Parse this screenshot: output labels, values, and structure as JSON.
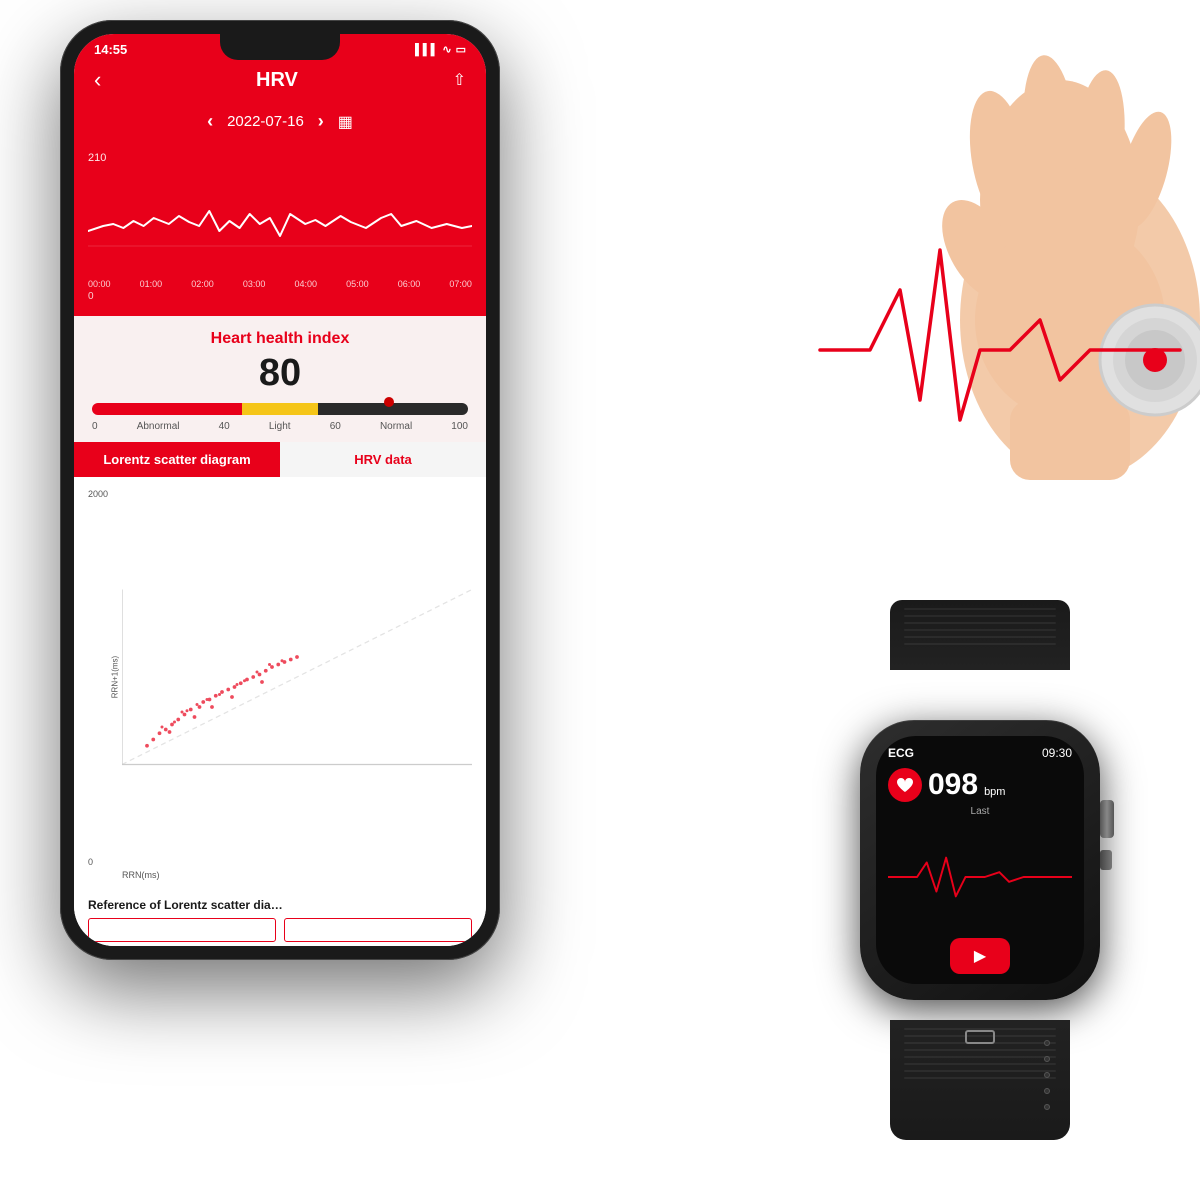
{
  "page": {
    "background": "#ffffff"
  },
  "phone": {
    "status_bar": {
      "time": "14:55",
      "signal": "▌▌▌",
      "wifi": "WiFi",
      "battery": "🔋"
    },
    "header": {
      "back_label": "‹",
      "title": "HRV",
      "share_label": "⎘"
    },
    "date_bar": {
      "prev_label": "‹",
      "date": "2022-07-16",
      "next_label": "›",
      "calendar_label": "📅"
    },
    "chart": {
      "y_top": "210",
      "y_bottom": "0",
      "x_labels": [
        "00:00",
        "01:00",
        "02:00",
        "03:00",
        "04:00",
        "05:00",
        "06:00",
        "07:00"
      ]
    },
    "health": {
      "title": "Heart health index",
      "value": "80",
      "gauge_labels": [
        "0",
        "Abnormal",
        "40",
        "Light",
        "60",
        "Normal",
        "100"
      ]
    },
    "tabs": [
      {
        "label": "Lorentz scatter diagram",
        "active": true
      },
      {
        "label": "HRV data",
        "active": false
      }
    ],
    "scatter": {
      "y_top": "2000",
      "y_bottom": "0",
      "y_axis_label": "RRN+1(ms)",
      "x_axis_label": "RRN(ms)"
    },
    "reference": {
      "title": "Reference of Lorentz scatter dia…"
    }
  },
  "watch": {
    "screen": {
      "ecg_label": "ECG",
      "time": "09:30",
      "bpm_value": "098",
      "bpm_unit": "bpm",
      "last_label": "Last",
      "play_icon": "▶"
    }
  },
  "icons": {
    "heart": "♥",
    "back": "‹",
    "share": "⇧",
    "calendar": "☰",
    "play": "▶"
  }
}
